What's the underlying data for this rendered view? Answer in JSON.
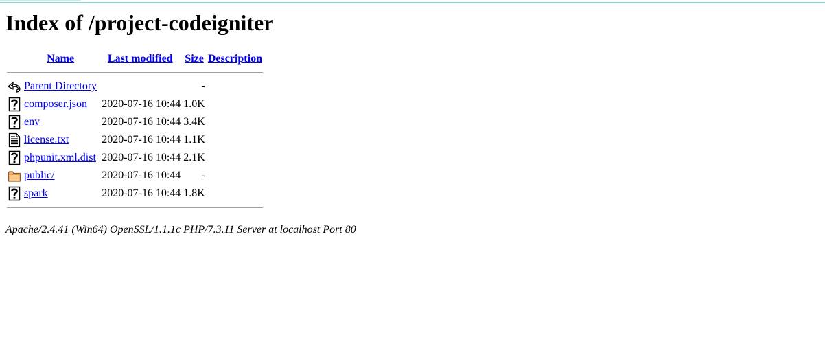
{
  "colors": {
    "accent_bar": "#8fcfcf",
    "link": "#0000ee"
  },
  "page": {
    "title": "Index of /project-codeigniter"
  },
  "columns": {
    "name": "Name",
    "last_modified": "Last modified",
    "size": "Size",
    "description": "Description"
  },
  "parent": {
    "icon": "back-arrow-icon",
    "name": "Parent Directory",
    "modified": "",
    "size": "-",
    "description": ""
  },
  "entries": [
    {
      "icon": "unknown-file-icon",
      "name": "composer.json",
      "modified": "2020-07-16 10:44",
      "size": "1.0K",
      "description": ""
    },
    {
      "icon": "unknown-file-icon",
      "name": "env",
      "modified": "2020-07-16 10:44",
      "size": "3.4K",
      "description": ""
    },
    {
      "icon": "text-file-icon",
      "name": "license.txt",
      "modified": "2020-07-16 10:44",
      "size": "1.1K",
      "description": ""
    },
    {
      "icon": "unknown-file-icon",
      "name": "phpunit.xml.dist",
      "modified": "2020-07-16 10:44",
      "size": "2.1K",
      "description": ""
    },
    {
      "icon": "folder-icon",
      "name": "public/",
      "modified": "2020-07-16 10:44",
      "size": "-",
      "description": ""
    },
    {
      "icon": "unknown-file-icon",
      "name": "spark",
      "modified": "2020-07-16 10:44",
      "size": "1.8K",
      "description": ""
    }
  ],
  "footer": {
    "server": "Apache/2.4.41 (Win64) OpenSSL/1.1.1c PHP/7.3.11 Server at localhost Port 80"
  }
}
